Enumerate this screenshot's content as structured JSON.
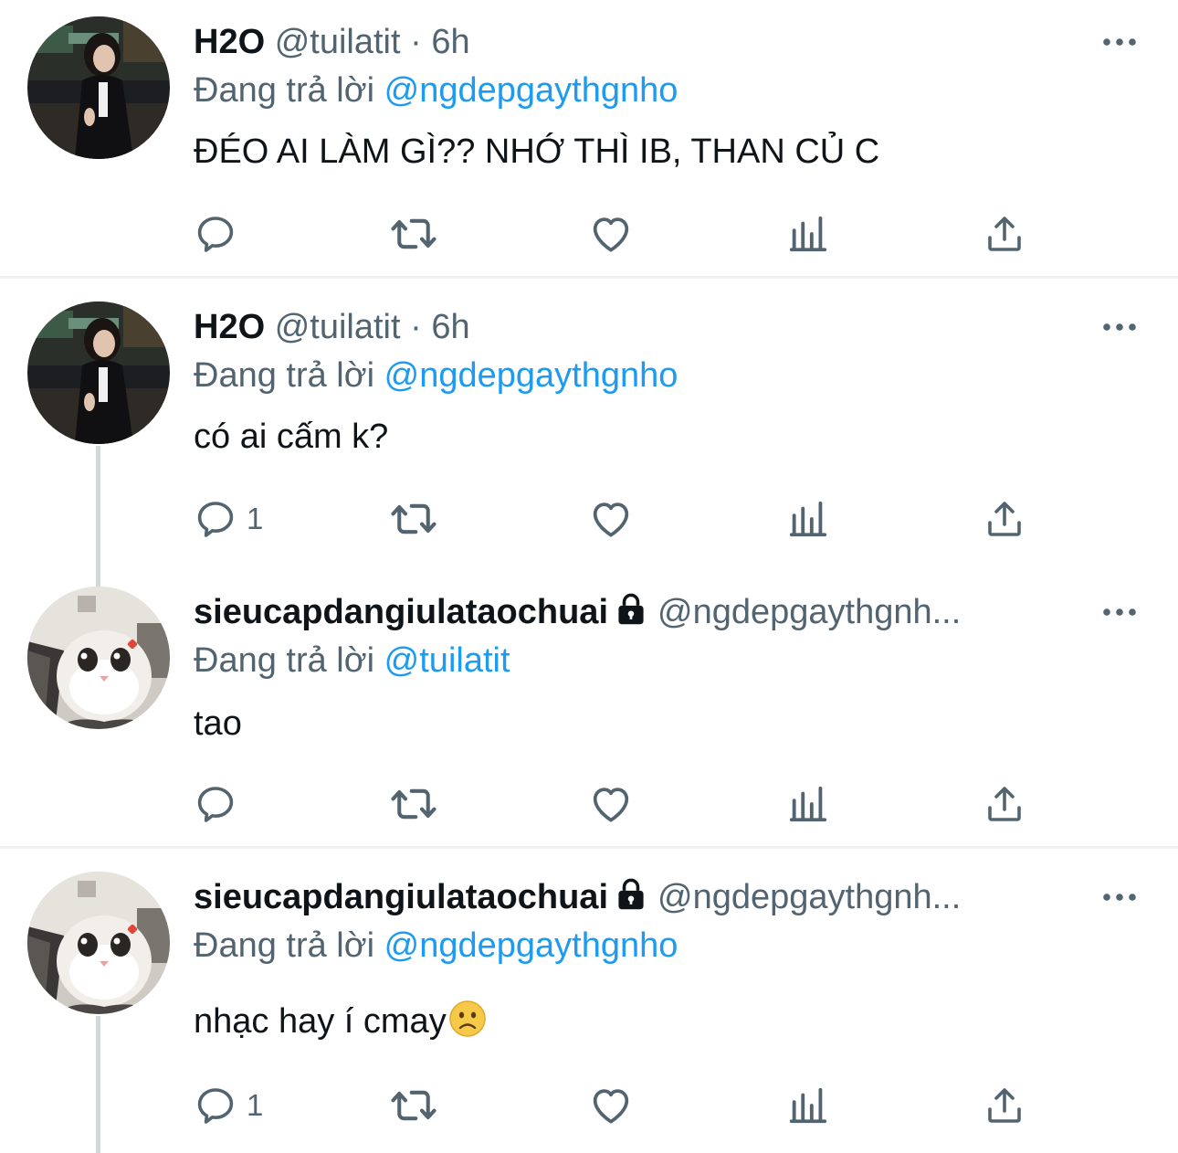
{
  "tweets": [
    {
      "name": "H2O",
      "handle": "@tuilatit",
      "dot": "·",
      "time": "6h",
      "reply_prefix": "Đang trả lời",
      "reply_mention": "@ngdepgaythgnho",
      "text": "ĐÉO AI LÀM GÌ?? NHỚ THÌ IB, THAN CỦ C",
      "reply_count": "",
      "avatar_icon": "girl-photo-avatar"
    },
    {
      "name": "H2O",
      "handle": "@tuilatit",
      "dot": "·",
      "time": "6h",
      "reply_prefix": "Đang trả lời",
      "reply_mention": "@ngdepgaythgnho",
      "text": "có ai cấm k?",
      "reply_count": "1",
      "avatar_icon": "girl-photo-avatar"
    },
    {
      "name": "sieucapdangiulataochuai",
      "handle": "@ngdepgaythgnh...",
      "reply_prefix": "Đang trả lời",
      "reply_mention": "@tuilatit",
      "text": "tao",
      "reply_count": "",
      "avatar_icon": "cat-photo-avatar",
      "locked": true
    },
    {
      "name": "sieucapdangiulataochuai",
      "handle": "@ngdepgaythgnh...",
      "reply_prefix": "Đang trả lời",
      "reply_mention": "@ngdepgaythgnho",
      "text": "nhạc hay í cmay",
      "reply_count": "1",
      "avatar_icon": "cat-photo-avatar",
      "locked": true,
      "emoji": "slightly-frowning-face"
    }
  ],
  "colors": {
    "text": "#0f1419",
    "secondary": "#536471",
    "link": "#1d9bf0",
    "divider": "#eff3f4",
    "thread_line": "#cfd9de"
  },
  "icons": [
    "reply-icon",
    "retweet-icon",
    "like-icon",
    "views-icon",
    "share-icon",
    "more-icon",
    "lock-icon"
  ]
}
